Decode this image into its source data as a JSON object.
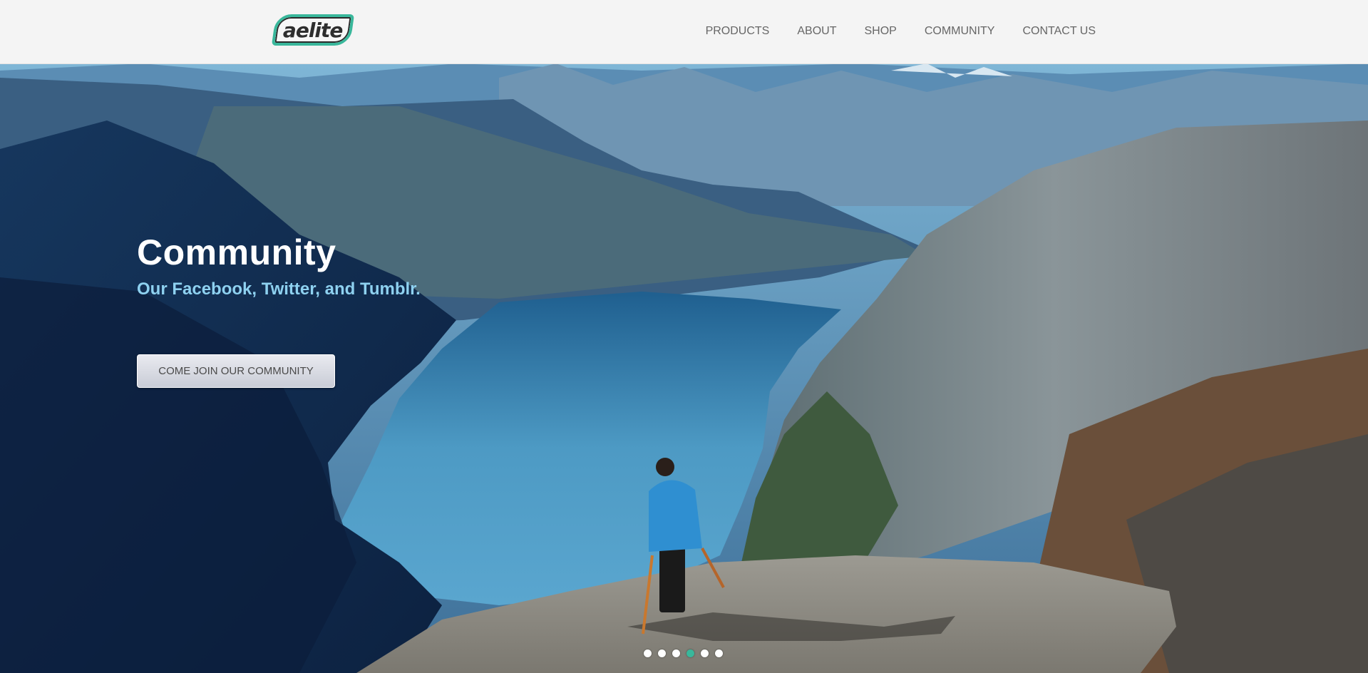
{
  "brand": {
    "logo_text": "aelite",
    "accent_color": "#39b79b"
  },
  "nav": {
    "items": [
      {
        "label": "PRODUCTS"
      },
      {
        "label": "ABOUT"
      },
      {
        "label": "SHOP"
      },
      {
        "label": "COMMUNITY"
      },
      {
        "label": "CONTACT US"
      }
    ]
  },
  "hero": {
    "title": "Community",
    "subtitle": "Our Facebook, Twitter, and Tumblr.",
    "cta_label": "COME JOIN OUR COMMUNITY",
    "background_image": "mountain-fjord-hiker-photo",
    "slider": {
      "slide_count": 6,
      "active_index": 3
    }
  }
}
